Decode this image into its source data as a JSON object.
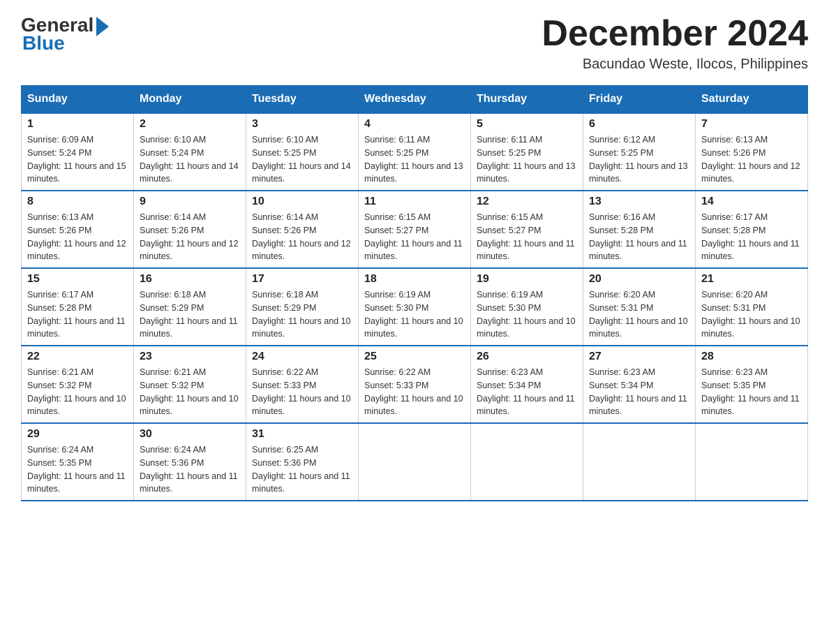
{
  "header": {
    "logo_general": "General",
    "logo_blue": "Blue",
    "month_title": "December 2024",
    "location": "Bacundao Weste, Ilocos, Philippines"
  },
  "days_of_week": [
    "Sunday",
    "Monday",
    "Tuesday",
    "Wednesday",
    "Thursday",
    "Friday",
    "Saturday"
  ],
  "weeks": [
    [
      {
        "day": "1",
        "sunrise": "6:09 AM",
        "sunset": "5:24 PM",
        "daylight": "11 hours and 15 minutes."
      },
      {
        "day": "2",
        "sunrise": "6:10 AM",
        "sunset": "5:24 PM",
        "daylight": "11 hours and 14 minutes."
      },
      {
        "day": "3",
        "sunrise": "6:10 AM",
        "sunset": "5:25 PM",
        "daylight": "11 hours and 14 minutes."
      },
      {
        "day": "4",
        "sunrise": "6:11 AM",
        "sunset": "5:25 PM",
        "daylight": "11 hours and 13 minutes."
      },
      {
        "day": "5",
        "sunrise": "6:11 AM",
        "sunset": "5:25 PM",
        "daylight": "11 hours and 13 minutes."
      },
      {
        "day": "6",
        "sunrise": "6:12 AM",
        "sunset": "5:25 PM",
        "daylight": "11 hours and 13 minutes."
      },
      {
        "day": "7",
        "sunrise": "6:13 AM",
        "sunset": "5:26 PM",
        "daylight": "11 hours and 12 minutes."
      }
    ],
    [
      {
        "day": "8",
        "sunrise": "6:13 AM",
        "sunset": "5:26 PM",
        "daylight": "11 hours and 12 minutes."
      },
      {
        "day": "9",
        "sunrise": "6:14 AM",
        "sunset": "5:26 PM",
        "daylight": "11 hours and 12 minutes."
      },
      {
        "day": "10",
        "sunrise": "6:14 AM",
        "sunset": "5:26 PM",
        "daylight": "11 hours and 12 minutes."
      },
      {
        "day": "11",
        "sunrise": "6:15 AM",
        "sunset": "5:27 PM",
        "daylight": "11 hours and 11 minutes."
      },
      {
        "day": "12",
        "sunrise": "6:15 AM",
        "sunset": "5:27 PM",
        "daylight": "11 hours and 11 minutes."
      },
      {
        "day": "13",
        "sunrise": "6:16 AM",
        "sunset": "5:28 PM",
        "daylight": "11 hours and 11 minutes."
      },
      {
        "day": "14",
        "sunrise": "6:17 AM",
        "sunset": "5:28 PM",
        "daylight": "11 hours and 11 minutes."
      }
    ],
    [
      {
        "day": "15",
        "sunrise": "6:17 AM",
        "sunset": "5:28 PM",
        "daylight": "11 hours and 11 minutes."
      },
      {
        "day": "16",
        "sunrise": "6:18 AM",
        "sunset": "5:29 PM",
        "daylight": "11 hours and 11 minutes."
      },
      {
        "day": "17",
        "sunrise": "6:18 AM",
        "sunset": "5:29 PM",
        "daylight": "11 hours and 10 minutes."
      },
      {
        "day": "18",
        "sunrise": "6:19 AM",
        "sunset": "5:30 PM",
        "daylight": "11 hours and 10 minutes."
      },
      {
        "day": "19",
        "sunrise": "6:19 AM",
        "sunset": "5:30 PM",
        "daylight": "11 hours and 10 minutes."
      },
      {
        "day": "20",
        "sunrise": "6:20 AM",
        "sunset": "5:31 PM",
        "daylight": "11 hours and 10 minutes."
      },
      {
        "day": "21",
        "sunrise": "6:20 AM",
        "sunset": "5:31 PM",
        "daylight": "11 hours and 10 minutes."
      }
    ],
    [
      {
        "day": "22",
        "sunrise": "6:21 AM",
        "sunset": "5:32 PM",
        "daylight": "11 hours and 10 minutes."
      },
      {
        "day": "23",
        "sunrise": "6:21 AM",
        "sunset": "5:32 PM",
        "daylight": "11 hours and 10 minutes."
      },
      {
        "day": "24",
        "sunrise": "6:22 AM",
        "sunset": "5:33 PM",
        "daylight": "11 hours and 10 minutes."
      },
      {
        "day": "25",
        "sunrise": "6:22 AM",
        "sunset": "5:33 PM",
        "daylight": "11 hours and 10 minutes."
      },
      {
        "day": "26",
        "sunrise": "6:23 AM",
        "sunset": "5:34 PM",
        "daylight": "11 hours and 11 minutes."
      },
      {
        "day": "27",
        "sunrise": "6:23 AM",
        "sunset": "5:34 PM",
        "daylight": "11 hours and 11 minutes."
      },
      {
        "day": "28",
        "sunrise": "6:23 AM",
        "sunset": "5:35 PM",
        "daylight": "11 hours and 11 minutes."
      }
    ],
    [
      {
        "day": "29",
        "sunrise": "6:24 AM",
        "sunset": "5:35 PM",
        "daylight": "11 hours and 11 minutes."
      },
      {
        "day": "30",
        "sunrise": "6:24 AM",
        "sunset": "5:36 PM",
        "daylight": "11 hours and 11 minutes."
      },
      {
        "day": "31",
        "sunrise": "6:25 AM",
        "sunset": "5:36 PM",
        "daylight": "11 hours and 11 minutes."
      },
      null,
      null,
      null,
      null
    ]
  ],
  "labels": {
    "sunrise": "Sunrise:",
    "sunset": "Sunset:",
    "daylight": "Daylight:"
  }
}
